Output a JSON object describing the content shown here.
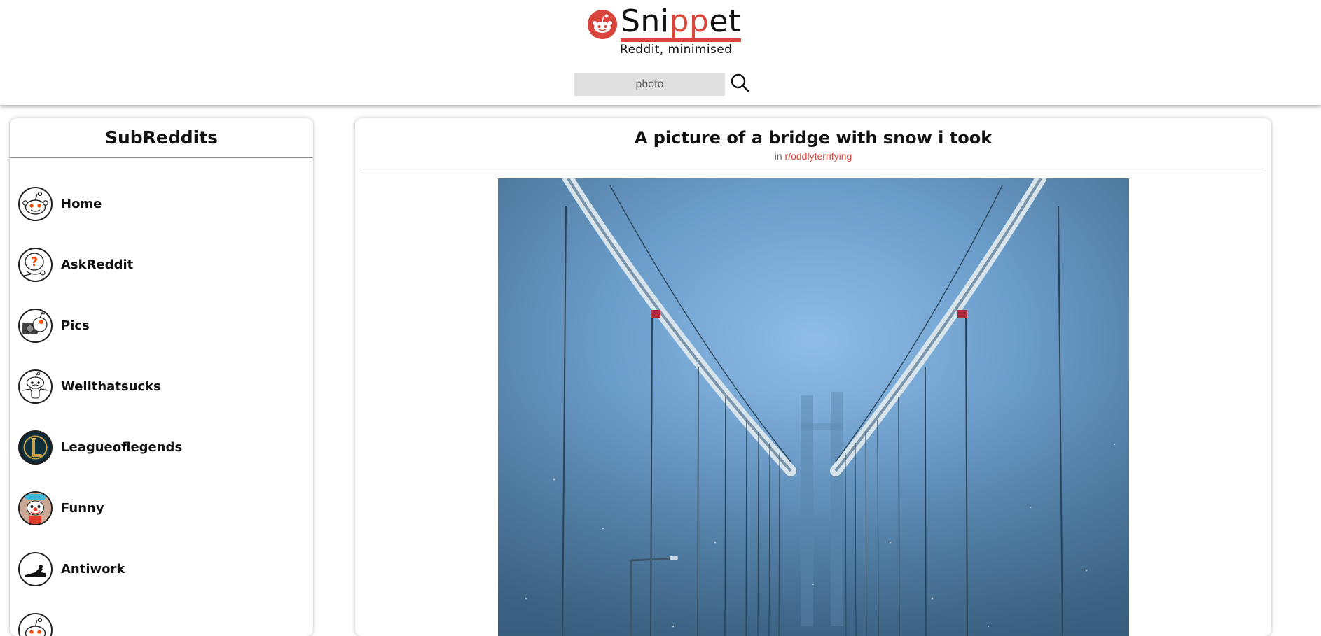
{
  "header": {
    "brand_prefix": "Sni",
    "brand_mid": "pp",
    "brand_suffix": "et",
    "tagline": "Reddit, minimised",
    "search_placeholder": "photo",
    "search_value": "",
    "accent_color": "#d9453c",
    "search_icon": "magnifier-icon"
  },
  "sidebar": {
    "title": "SubReddits",
    "items": [
      {
        "label": "Home",
        "icon": "reddit-alien-icon"
      },
      {
        "label": "AskReddit",
        "icon": "question-alien-icon"
      },
      {
        "label": "Pics",
        "icon": "camera-alien-icon"
      },
      {
        "label": "Wellthatsucks",
        "icon": "sad-alien-icon"
      },
      {
        "label": "Leagueoflegends",
        "icon": "league-logo-icon"
      },
      {
        "label": "Funny",
        "icon": "clown-alien-icon"
      },
      {
        "label": "Antiwork",
        "icon": "lounging-figure-icon"
      },
      {
        "label": "",
        "icon": "reddit-alien-icon"
      }
    ]
  },
  "post": {
    "title": "A picture of a bridge with snow i took",
    "meta_prefix": "in",
    "subreddit": "r/oddlyterrifying",
    "image_alt": "suspension-bridge-in-snow-fog-photo"
  }
}
